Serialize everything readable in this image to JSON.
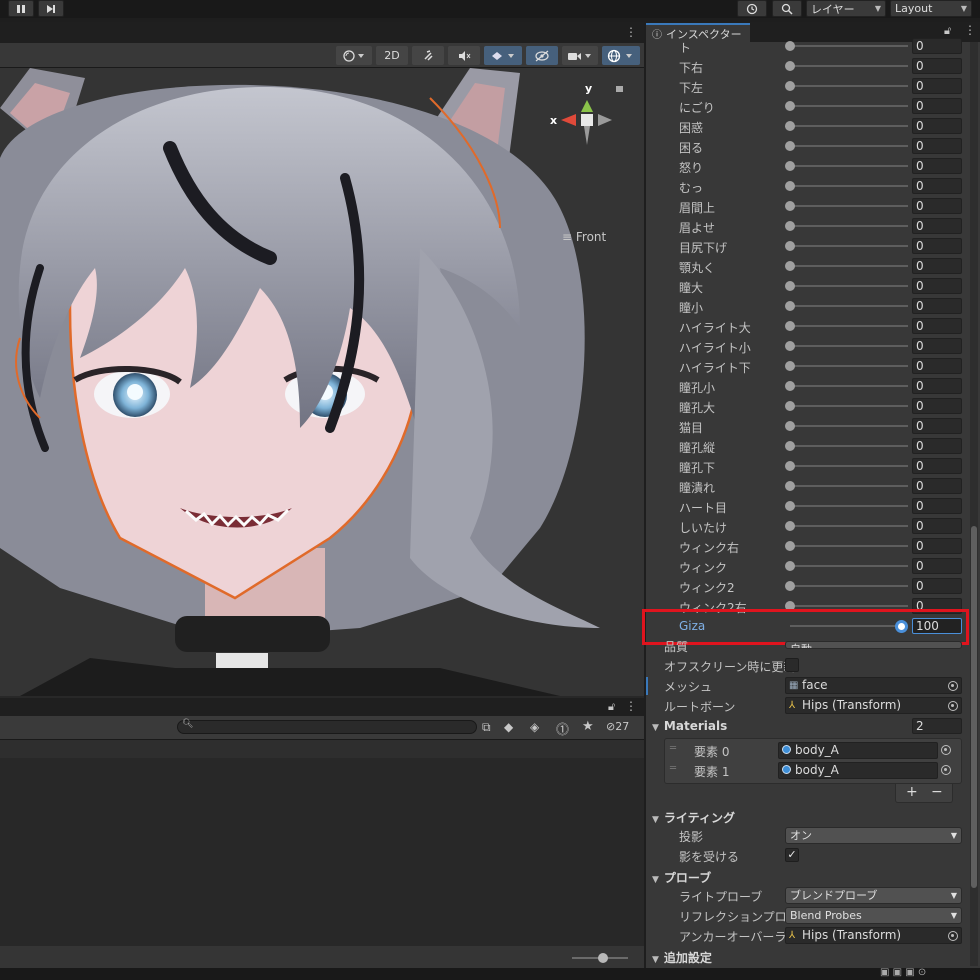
{
  "toolbar": {
    "history_icon": "history-icon",
    "search_icon": "search-icon",
    "layers_label": "レイヤー",
    "layout_label": "Layout"
  },
  "scene": {
    "mode_2d": "2D",
    "gizmo_axis_x": "x",
    "gizmo_axis_y": "y",
    "view_label": "Front"
  },
  "bottom_panel": {
    "hidden_count": "27"
  },
  "inspector": {
    "tab_label": "インスペクター",
    "blendshapes": [
      {
        "name": "ト",
        "value": "0"
      },
      {
        "name": "下右",
        "value": "0"
      },
      {
        "name": "下左",
        "value": "0"
      },
      {
        "name": "にごり",
        "value": "0"
      },
      {
        "name": "困惑",
        "value": "0"
      },
      {
        "name": "困る",
        "value": "0"
      },
      {
        "name": "怒り",
        "value": "0"
      },
      {
        "name": "むっ",
        "value": "0"
      },
      {
        "name": "眉間上",
        "value": "0"
      },
      {
        "name": "眉よせ",
        "value": "0"
      },
      {
        "name": "目尻下げ",
        "value": "0"
      },
      {
        "name": "顎丸く",
        "value": "0"
      },
      {
        "name": "瞳大",
        "value": "0"
      },
      {
        "name": "瞳小",
        "value": "0"
      },
      {
        "name": "ハイライト大",
        "value": "0"
      },
      {
        "name": "ハイライト小",
        "value": "0"
      },
      {
        "name": "ハイライト下",
        "value": "0"
      },
      {
        "name": "瞳孔小",
        "value": "0"
      },
      {
        "name": "瞳孔大",
        "value": "0"
      },
      {
        "name": "猫目",
        "value": "0"
      },
      {
        "name": "瞳孔縦",
        "value": "0"
      },
      {
        "name": "瞳孔下",
        "value": "0"
      },
      {
        "name": "瞳潰れ",
        "value": "0"
      },
      {
        "name": "ハート目",
        "value": "0"
      },
      {
        "name": "しいたけ",
        "value": "0"
      },
      {
        "name": "ウィンク右",
        "value": "0"
      },
      {
        "name": "ウィンク",
        "value": "0"
      },
      {
        "name": "ウィンク2",
        "value": "0"
      },
      {
        "name": "ウィンク2右",
        "value": "0"
      }
    ],
    "giza": {
      "name": "Giza",
      "value": "100",
      "fraction": 1.0
    },
    "quality": {
      "label": "品質",
      "value": "自動"
    },
    "offscreen": {
      "label": "オフスクリーン時に更新",
      "checked": false
    },
    "mesh": {
      "label": "メッシュ",
      "value": "face",
      "icon": "mesh-icon"
    },
    "root_bone": {
      "label": "ルートボーン",
      "value": "Hips (Transform)",
      "icon": "transform-icon"
    },
    "materials": {
      "label": "Materials",
      "count": "2",
      "items": [
        {
          "label": "要素 0",
          "value": "body_A",
          "icon": "material-icon"
        },
        {
          "label": "要素 1",
          "value": "body_A",
          "icon": "material-icon"
        }
      ],
      "add_label": "+",
      "remove_label": "−"
    },
    "lighting": {
      "label": "ライティング",
      "cast_shadows": {
        "label": "投影",
        "value": "オン"
      },
      "receive_shadows": {
        "label": "影を受ける",
        "checked": true
      }
    },
    "probes": {
      "label": "プローブ",
      "light_probe": {
        "label": "ライトプローブ",
        "value": "ブレンドプローブ"
      },
      "reflection_probe": {
        "label": "リフレクションプローブ",
        "value": "Blend Probes"
      },
      "anchor_override": {
        "label": "アンカーオーバーライド",
        "value": "Hips (Transform)",
        "icon": "transform-icon"
      }
    },
    "additional": {
      "label": "追加設定"
    }
  },
  "colors": {
    "highlight": "#e0141e",
    "accent": "#3a79bb"
  }
}
